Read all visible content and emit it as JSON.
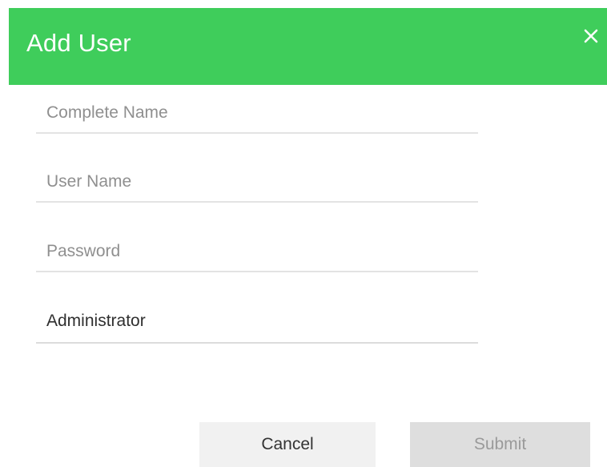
{
  "dialog": {
    "title": "Add User",
    "close_icon": "close-icon",
    "header_color": "#3fcd5b"
  },
  "form": {
    "complete_name": {
      "placeholder": "Complete Name",
      "value": ""
    },
    "user_name": {
      "placeholder": "User Name",
      "value": ""
    },
    "password": {
      "placeholder": "Password",
      "value": ""
    },
    "role": {
      "selected": "Administrator"
    }
  },
  "actions": {
    "cancel_label": "Cancel",
    "submit_label": "Submit"
  }
}
